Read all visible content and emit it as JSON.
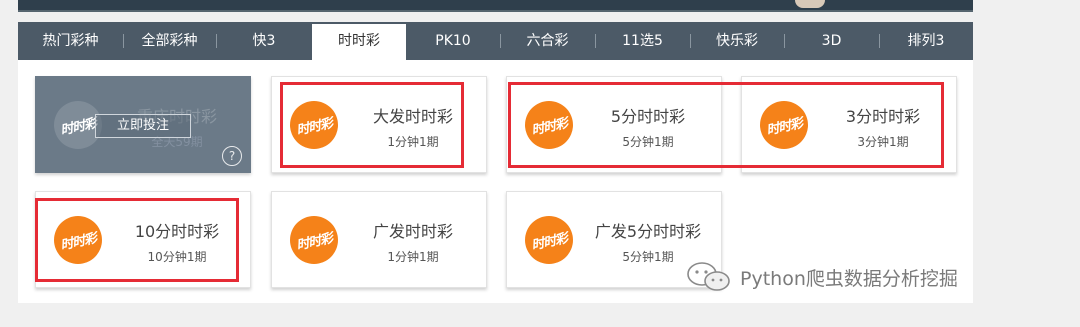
{
  "tabs": [
    {
      "label": "热门彩种",
      "active": false
    },
    {
      "label": "全部彩种",
      "active": false
    },
    {
      "label": "快3",
      "active": false
    },
    {
      "label": "时时彩",
      "active": true
    },
    {
      "label": "PK10",
      "active": false
    },
    {
      "label": "六合彩",
      "active": false
    },
    {
      "label": "11选5",
      "active": false
    },
    {
      "label": "快乐彩",
      "active": false
    },
    {
      "label": "3D",
      "active": false
    },
    {
      "label": "排列3",
      "active": false
    }
  ],
  "games": [
    {
      "name": "重庆时时彩",
      "period": "全天59期",
      "hovered": true
    },
    {
      "name": "大发时时彩",
      "period": "1分钟1期"
    },
    {
      "name": "5分时时彩",
      "period": "5分钟1期"
    },
    {
      "name": "3分时时彩",
      "period": "3分钟1期"
    },
    {
      "name": "10分时时彩",
      "period": "10分钟1期"
    },
    {
      "name": "广发时时彩",
      "period": "1分钟1期"
    },
    {
      "name": "广发5分时时彩",
      "period": "5分钟1期"
    }
  ],
  "hover": {
    "bet_label": "立即投注",
    "help_label": "?"
  },
  "logo_text": "时时彩",
  "watermark": "Python爬虫数据分析挖掘",
  "colors": {
    "nav_bg": "#4c5a67",
    "logo": "#f58219",
    "highlight": "#e52b35"
  }
}
